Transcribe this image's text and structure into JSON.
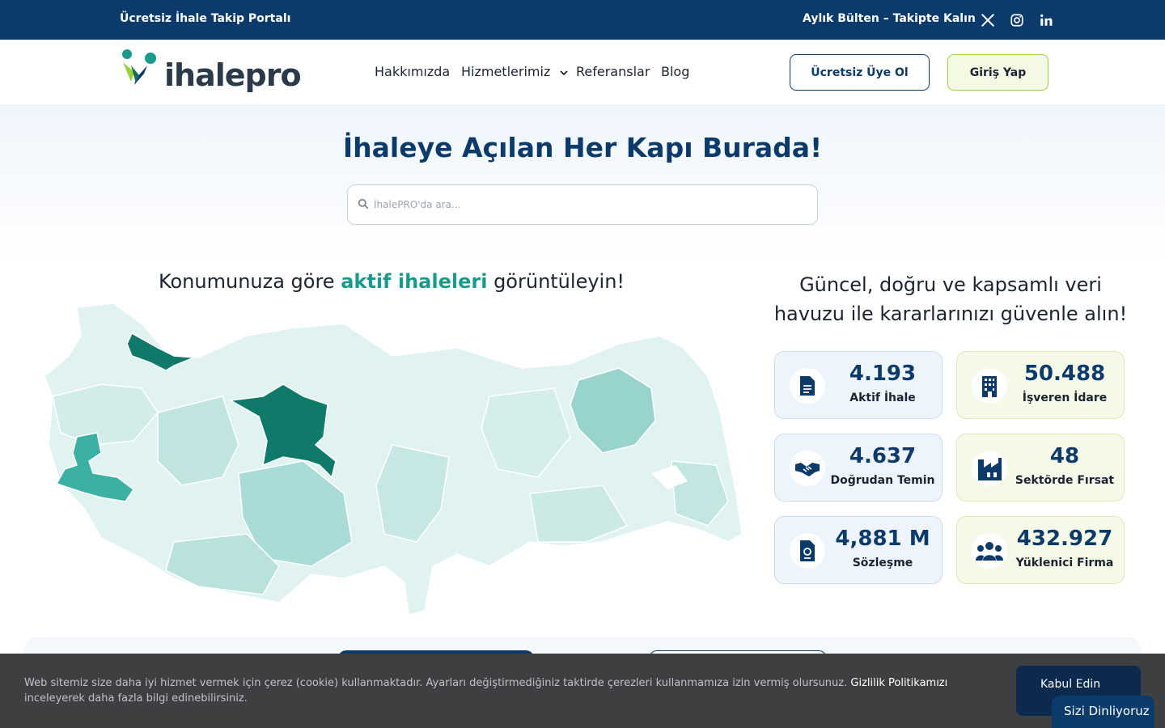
{
  "topbar": {
    "left_text": "Ücretsiz İhale Takip Portalı",
    "newsletter": "Aylık Bülten – Takipte Kalın",
    "social_icons": [
      "x-icon",
      "instagram-icon",
      "linkedin-icon"
    ]
  },
  "header": {
    "logo_text": "ihalepro",
    "nav": [
      "Hakkımızda",
      "Hizmetlerimiz",
      "Referanslar",
      "Blog"
    ],
    "register_label": "Ücretsiz Üye Ol",
    "login_label": "Giriş Yap"
  },
  "hero": {
    "title": "İhaleye Açılan Her Kapı Burada!",
    "search_placeholder": "İhalePRO'da ara..."
  },
  "map": {
    "title_prefix": "Konumunuza göre ",
    "title_highlight": "aktif ihaleleri",
    "title_suffix": " görüntüleyin!"
  },
  "stats": {
    "title": "Güncel, doğru ve kapsamlı veri havuzu ile kararlarınızı güvenle alın!",
    "cards": [
      {
        "value": "4.193",
        "label": "Aktif İhale",
        "icon": "document-icon"
      },
      {
        "value": "50.488",
        "label": "İşveren İdare",
        "icon": "building-icon"
      },
      {
        "value": "4.637",
        "label": "Doğrudan Temin",
        "icon": "handshake-icon"
      },
      {
        "value": "48",
        "label": "Sektörde Fırsat",
        "icon": "industry-icon"
      },
      {
        "value": "4,881 M",
        "label": "Sözleşme",
        "icon": "contract-icon"
      },
      {
        "value": "432.927",
        "label": "Yüklenici Firma",
        "icon": "users-icon"
      }
    ]
  },
  "cookie": {
    "text": "Web sitemiz size daha iyi hizmet vermek için çerez (cookie) kullanmaktadır. Ayarları değiştirmediğiniz taktirde çerezleri kullanmamıza izin vermiş olursunuz.",
    "link": "Gizlilik Politikamızı",
    "text_after": " inceleyerek daha fazla bilgi edinebilirsiniz.",
    "accept_label": "Kabul Edin"
  },
  "chat_label": "Sizi Dinliyoruz",
  "colors": {
    "primary": "#0c3a6b",
    "accent": "#1a9a8a",
    "lime": "#9bd13b"
  }
}
